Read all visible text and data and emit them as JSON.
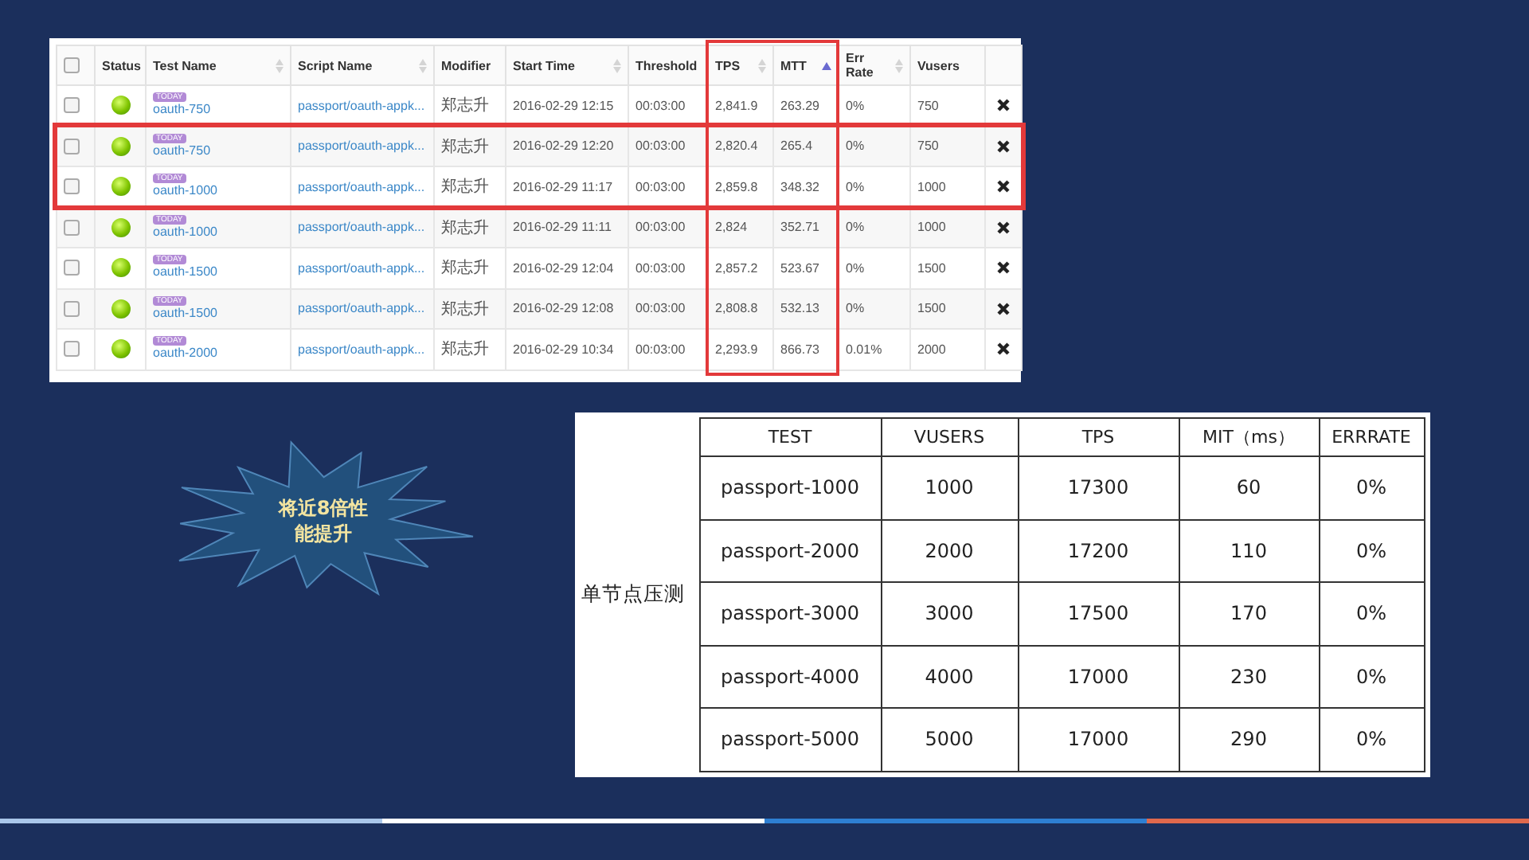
{
  "results_table": {
    "header_checkbox": {
      "checked": false
    },
    "columns": [
      {
        "label": "Status",
        "sortable": false,
        "sorted": false,
        "highlighted": false
      },
      {
        "label": "Test Name",
        "sortable": true,
        "sorted": false,
        "highlighted": false
      },
      {
        "label": "Script Name",
        "sortable": true,
        "sorted": false,
        "highlighted": false
      },
      {
        "label": "Modifier",
        "sortable": false,
        "sorted": false,
        "highlighted": false
      },
      {
        "label": "Start Time",
        "sortable": true,
        "sorted": false,
        "highlighted": false
      },
      {
        "label": "Threshold",
        "sortable": false,
        "sorted": false,
        "highlighted": false
      },
      {
        "label": "TPS",
        "sortable": true,
        "sorted": false,
        "highlighted": true
      },
      {
        "label": "MTT",
        "sortable": true,
        "sorted": true,
        "highlighted": true
      },
      {
        "label": "Err Rate",
        "sortable": true,
        "sorted": false,
        "highlighted": false
      },
      {
        "label": "Vusers",
        "sortable": false,
        "sorted": false,
        "highlighted": false
      }
    ],
    "rows": [
      {
        "checked": false,
        "status_ok": true,
        "badge": "TODAY",
        "test_name": "oauth-750",
        "script_name": "passport/oauth-appk...",
        "modifier": "郑志升",
        "start_time": "2016-02-29 12:15",
        "threshold": "00:03:00",
        "tps": "2,841.9",
        "mtt": "263.29",
        "err_rate": "0%",
        "vusers": "750",
        "highlighted": false
      },
      {
        "checked": false,
        "status_ok": true,
        "badge": "TODAY",
        "test_name": "oauth-750",
        "script_name": "passport/oauth-appk...",
        "modifier": "郑志升",
        "start_time": "2016-02-29 12:20",
        "threshold": "00:03:00",
        "tps": "2,820.4",
        "mtt": "265.4",
        "err_rate": "0%",
        "vusers": "750",
        "highlighted": true
      },
      {
        "checked": false,
        "status_ok": true,
        "badge": "TODAY",
        "test_name": "oauth-1000",
        "script_name": "passport/oauth-appk...",
        "modifier": "郑志升",
        "start_time": "2016-02-29 11:17",
        "threshold": "00:03:00",
        "tps": "2,859.8",
        "mtt": "348.32",
        "err_rate": "0%",
        "vusers": "1000",
        "highlighted": true
      },
      {
        "checked": false,
        "status_ok": true,
        "badge": "TODAY",
        "test_name": "oauth-1000",
        "script_name": "passport/oauth-appk...",
        "modifier": "郑志升",
        "start_time": "2016-02-29 11:11",
        "threshold": "00:03:00",
        "tps": "2,824",
        "mtt": "352.71",
        "err_rate": "0%",
        "vusers": "1000",
        "highlighted": false
      },
      {
        "checked": false,
        "status_ok": true,
        "badge": "TODAY",
        "test_name": "oauth-1500",
        "script_name": "passport/oauth-appk...",
        "modifier": "郑志升",
        "start_time": "2016-02-29 12:04",
        "threshold": "00:03:00",
        "tps": "2,857.2",
        "mtt": "523.67",
        "err_rate": "0%",
        "vusers": "1500",
        "highlighted": false
      },
      {
        "checked": false,
        "status_ok": true,
        "badge": "TODAY",
        "test_name": "oauth-1500",
        "script_name": "passport/oauth-appk...",
        "modifier": "郑志升",
        "start_time": "2016-02-29 12:08",
        "threshold": "00:03:00",
        "tps": "2,808.8",
        "mtt": "532.13",
        "err_rate": "0%",
        "vusers": "1500",
        "highlighted": false
      },
      {
        "checked": false,
        "status_ok": true,
        "badge": "TODAY",
        "test_name": "oauth-2000",
        "script_name": "passport/oauth-appk...",
        "modifier": "郑志升",
        "start_time": "2016-02-29 10:34",
        "threshold": "00:03:00",
        "tps": "2,293.9",
        "mtt": "866.73",
        "err_rate": "0.01%",
        "vusers": "2000",
        "highlighted": false
      }
    ]
  },
  "callout": {
    "lines": [
      "将近8倍性",
      "能提升"
    ]
  },
  "summary_table": {
    "row_header": "单节点压测",
    "columns": [
      "TEST",
      "VUSERS",
      "TPS",
      "MIT（ms）",
      "ERRRATE"
    ],
    "rows": [
      [
        "passport-1000",
        "1000",
        "17300",
        "60",
        "0%"
      ],
      [
        "passport-2000",
        "2000",
        "17200",
        "110",
        "0%"
      ],
      [
        "passport-3000",
        "3000",
        "17500",
        "170",
        "0%"
      ],
      [
        "passport-4000",
        "4000",
        "17000",
        "230",
        "0%"
      ],
      [
        "passport-5000",
        "5000",
        "17000",
        "290",
        "0%"
      ]
    ]
  },
  "footer_bar": {
    "segments": [
      {
        "color": "#a9c6ea"
      },
      {
        "color": "#ffffff"
      },
      {
        "color": "#2e7fd2"
      },
      {
        "color": "#e0694d"
      }
    ]
  }
}
